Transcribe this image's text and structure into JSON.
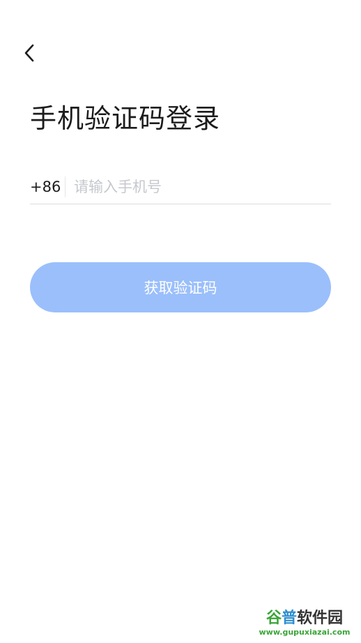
{
  "header": {
    "back_icon": "chevron-left-icon",
    "title": "手机验证码登录"
  },
  "phone": {
    "country_code": "+86",
    "placeholder": "请输入手机号",
    "value": ""
  },
  "actions": {
    "get_code_label": "获取验证码"
  },
  "colors": {
    "button_bg": "#9bbffb",
    "button_text": "#ffffff",
    "title_text": "#1c1c1c",
    "placeholder_text": "#c5c8ce"
  },
  "watermark": {
    "part1": "谷",
    "part2": "普",
    "part3": "软件园",
    "url": "www.gupuxiazai.com"
  }
}
